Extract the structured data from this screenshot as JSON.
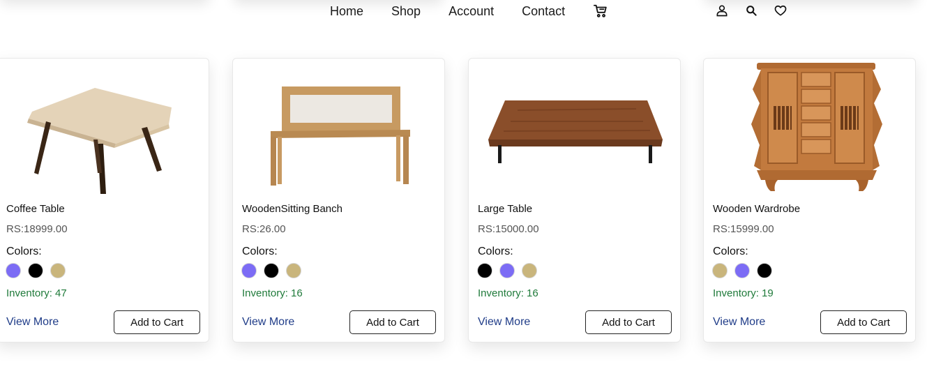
{
  "nav": {
    "links": [
      "Home",
      "Shop",
      "Account",
      "Contact"
    ],
    "icons": [
      "cart-icon",
      "user-icon",
      "search-icon",
      "heart-icon"
    ]
  },
  "colors": {
    "purple": "#7c6cf5",
    "black": "#000000",
    "tan": "#c9b57c",
    "inventory_green": "#1f7a3a",
    "link_blue": "#1f3c88"
  },
  "labels": {
    "colors": "Colors:",
    "inventory": "Inventory:",
    "view_more": "View More",
    "add_to_cart": "Add to Cart"
  },
  "products": [
    {
      "name": "Coffee Table",
      "price": "RS:18999.00",
      "image": "coffee-table-image",
      "swatches": [
        "#7c6cf5",
        "#000000",
        "#c9b57c"
      ],
      "inventory": "47"
    },
    {
      "name": "WoodenSitting Banch",
      "price": "RS:26.00",
      "image": "bench-image",
      "swatches": [
        "#7c6cf5",
        "#000000",
        "#c9b57c"
      ],
      "inventory": "16"
    },
    {
      "name": "Large Table",
      "price": "RS:15000.00",
      "image": "large-table-image",
      "swatches": [
        "#000000",
        "#7c6cf5",
        "#c9b57c"
      ],
      "inventory": "16"
    },
    {
      "name": "Wooden Wardrobe",
      "price": "RS:15999.00",
      "image": "wardrobe-image",
      "swatches": [
        "#c9b57c",
        "#7c6cf5",
        "#000000"
      ],
      "inventory": "19"
    }
  ]
}
